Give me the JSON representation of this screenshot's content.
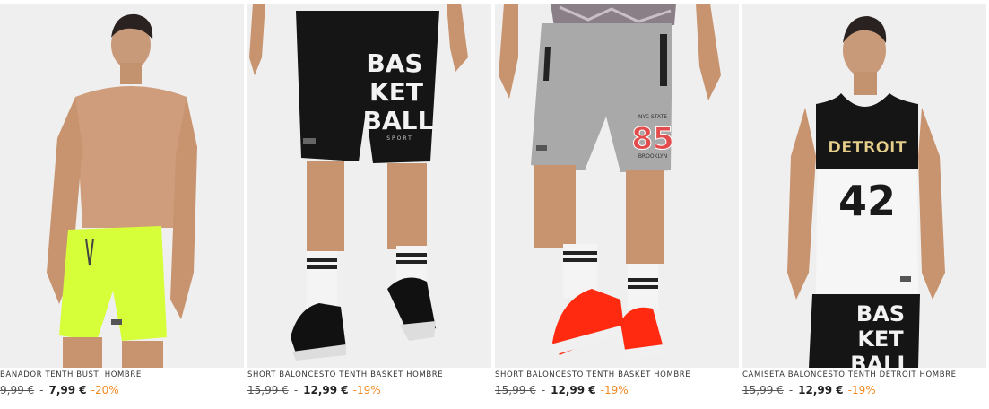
{
  "colors": {
    "discount": "#f08a24",
    "background": "#ffffff",
    "photo_background": "#efefef",
    "text": "#333333"
  },
  "products": [
    {
      "title": "BAÑADOR TENTH BUSTI HOMBRE",
      "old_price": "9,99 €",
      "separator": "-",
      "price": "7,99 €",
      "discount": "-20%",
      "photo_icon": "man-in-neon-swim-shorts"
    },
    {
      "title": "SHORT BALONCESTO TENTH BASKET HOMBRE",
      "old_price": "15,99 €",
      "separator": "-",
      "price": "12,99 €",
      "discount": "-19%",
      "photo_icon": "black-basketball-shorts",
      "print_lines": [
        "BAS",
        "KET",
        "BALL"
      ],
      "print_small": "SPORT"
    },
    {
      "title": "SHORT BALONCESTO TENTH BASKET HOMBRE",
      "old_price": "15,99 €",
      "separator": "-",
      "price": "12,99 €",
      "discount": "-19%",
      "photo_icon": "grey-basketball-shorts",
      "print_top": "NYC STATE",
      "print_number": "85",
      "print_bottom": "BROOKLYN"
    },
    {
      "title": "CAMISETA BALONCESTO TENTH DETROIT HOMBRE",
      "old_price": "15,99 €",
      "separator": "-",
      "price": "12,99 €",
      "discount": "-19%",
      "photo_icon": "detroit-basketball-tank",
      "print_city": "DETROIT",
      "print_number": "42",
      "print_lines": [
        "BAS",
        "KET",
        "BALL"
      ]
    }
  ]
}
